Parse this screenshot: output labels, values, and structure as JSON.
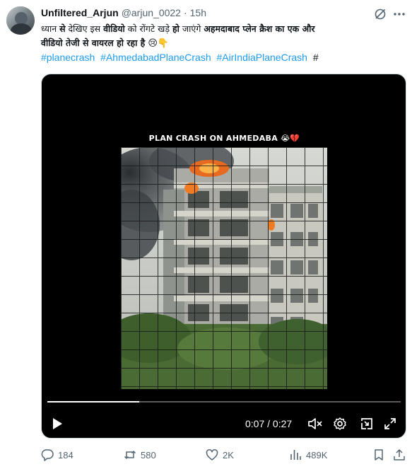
{
  "author": {
    "name": "Unfiltered_Arjun",
    "handle": "@arjun_0022",
    "separator": "·",
    "time": "15h"
  },
  "post": {
    "line1_a": "ध्यान ",
    "line1_b": "से",
    "line1_c": " देखिए इस ",
    "line1_d": "वीडियो",
    "line1_e": " को रोंगटे खड़े ",
    "line1_f": "हो",
    "line1_g": " जाएंगे ",
    "line1_h": "अहमदाबाद प्लेन क्रैश का एक और",
    "line2": "वीडियो तेजी से वायरल हो रहा है",
    "emoji_1": "😢",
    "emoji_2": "👇",
    "hashtags": [
      "#planecrash",
      "#AhmedabadPlaneCrash",
      "#AirIndiaPlaneCrash"
    ],
    "hashtag_trailing": "#"
  },
  "video": {
    "caption": "PLAN CRASH ON AHMEDABA",
    "caption_emoji": "😭💔",
    "current_time": "0:07",
    "time_separator": " / ",
    "duration": "0:27",
    "progress_fraction": 0.259,
    "icons": [
      "play-icon",
      "mute-icon",
      "settings-icon",
      "pip-icon",
      "fullscreen-icon"
    ]
  },
  "actions": {
    "replies": "184",
    "reposts": "580",
    "likes": "2K",
    "views": "489K"
  },
  "colors": {
    "link": "#1d9bf0",
    "secondary_text": "#536471",
    "primary_text": "#0f1419",
    "video_bg": "#000000"
  }
}
